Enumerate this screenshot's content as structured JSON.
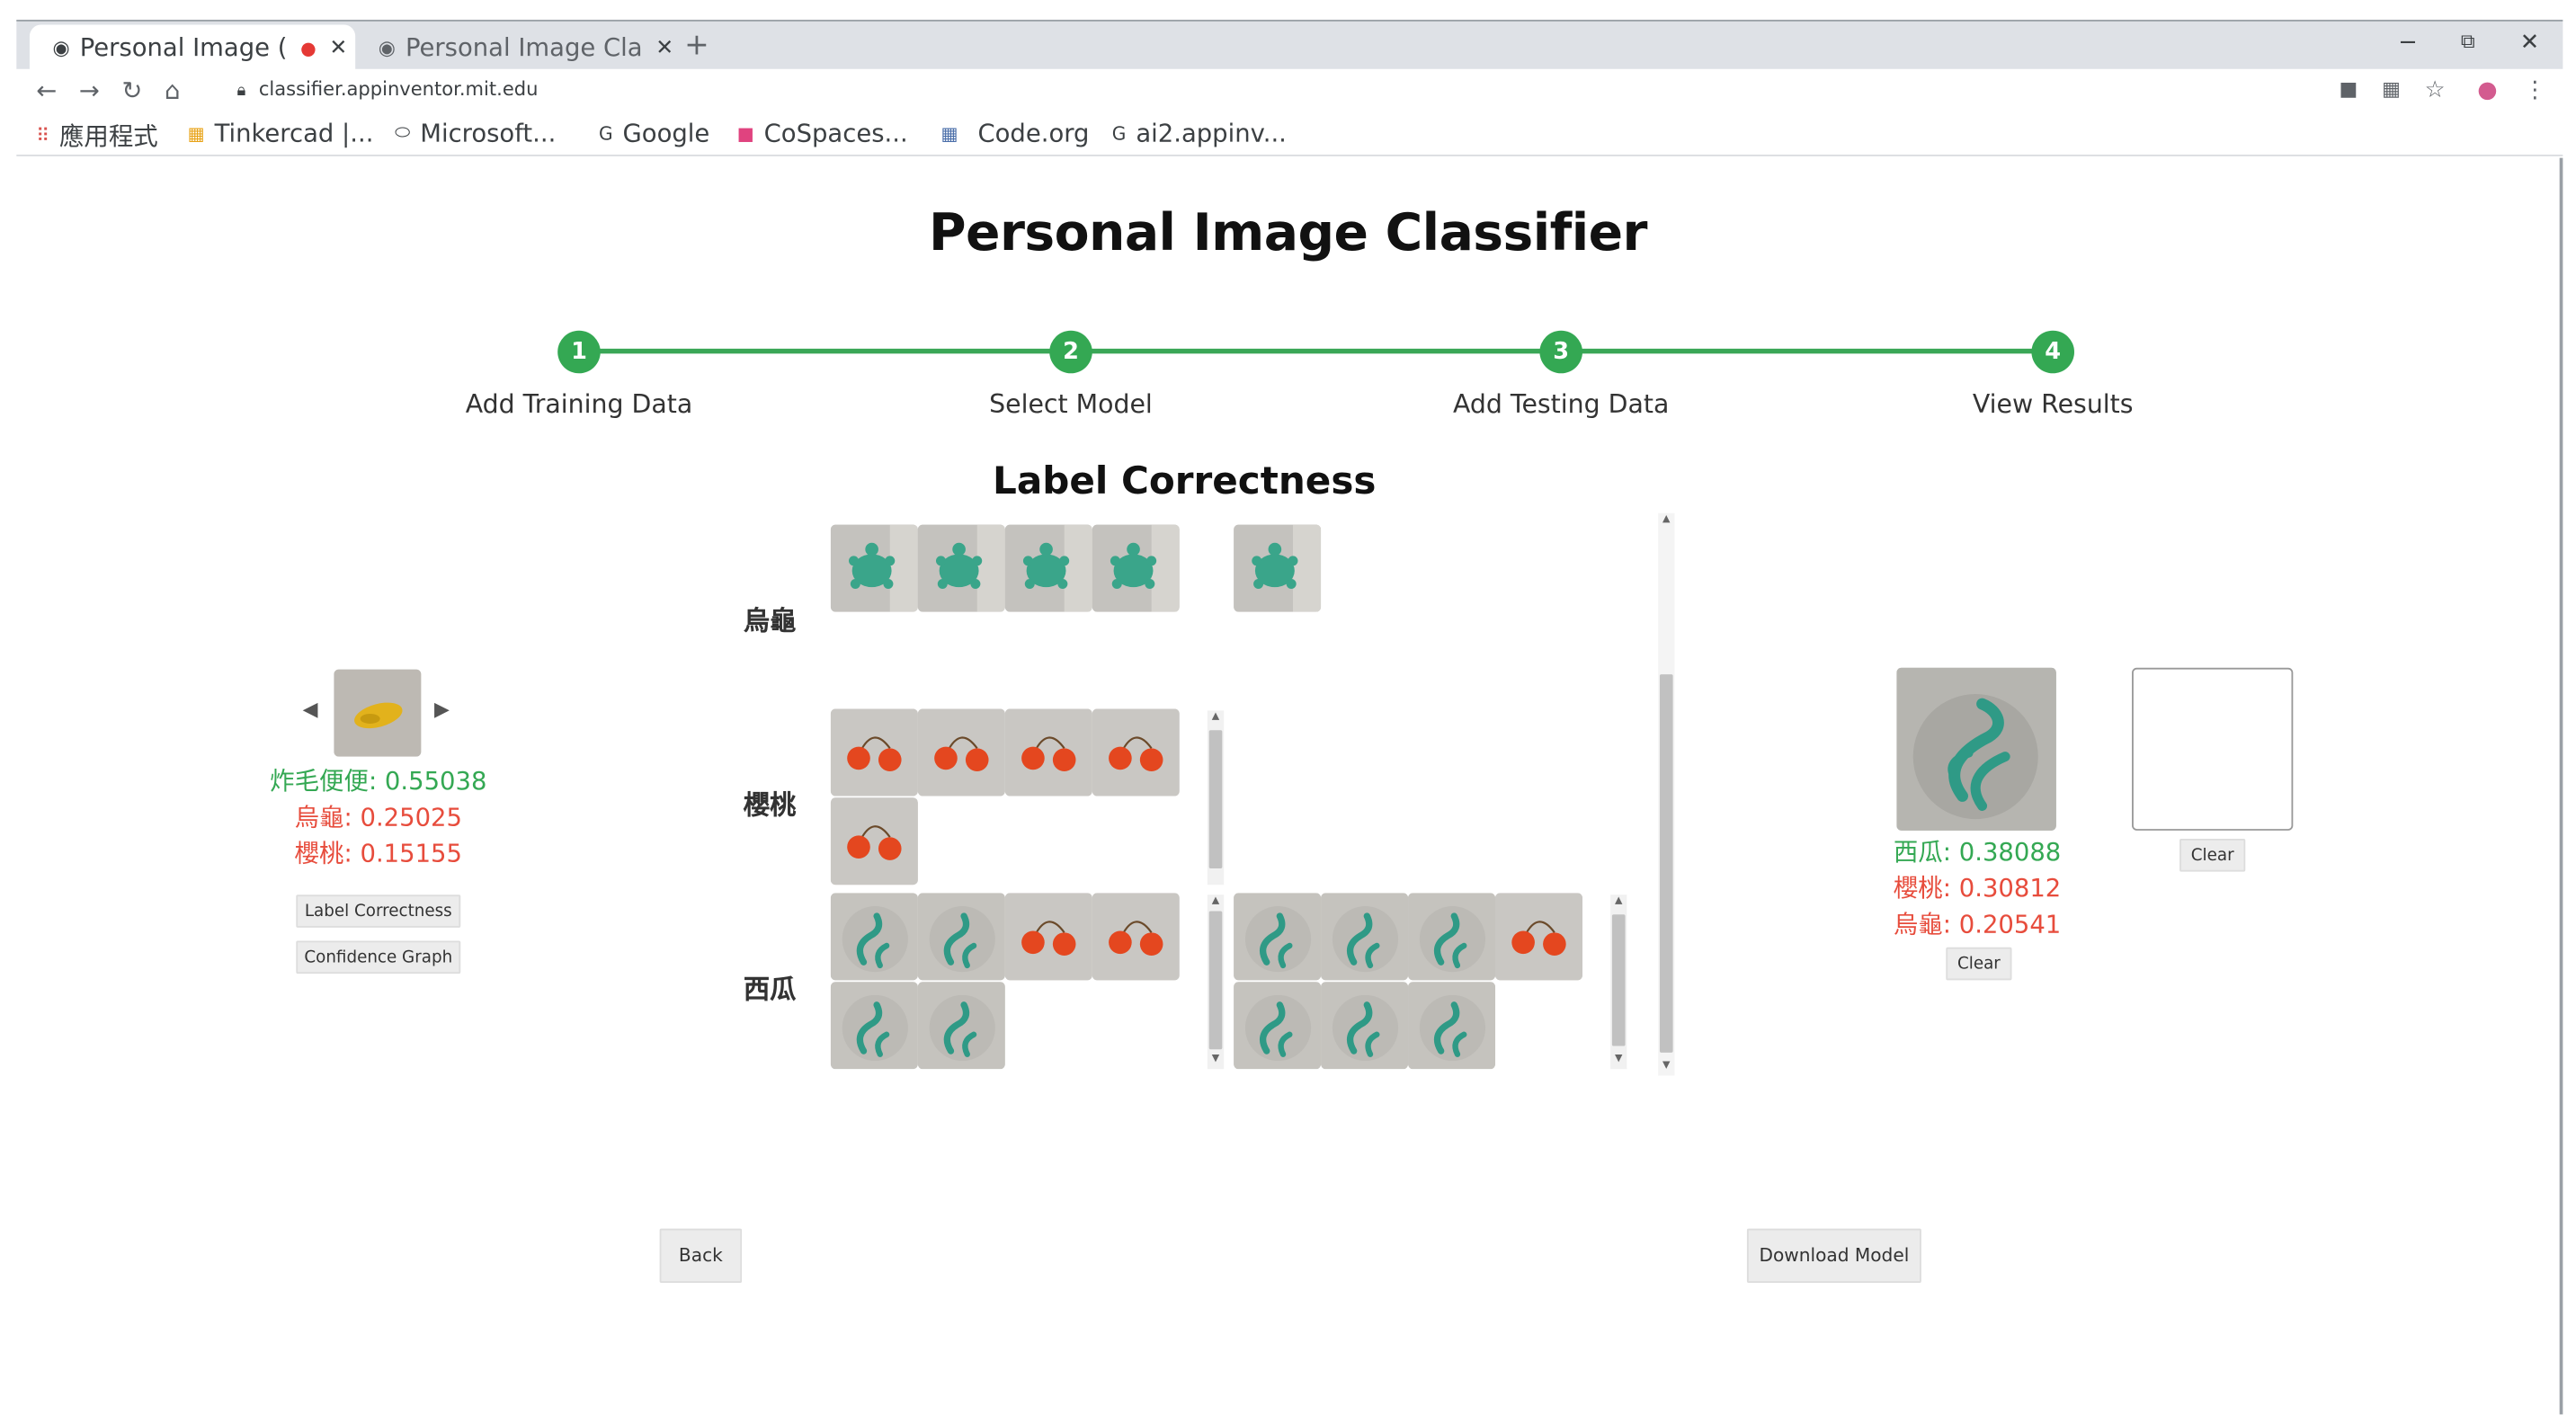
{
  "browser": {
    "tabs": [
      {
        "title": "Personal Image (",
        "active": true,
        "recording": true
      },
      {
        "title": "Personal Image Cla",
        "active": false,
        "recording": false
      }
    ],
    "new_tab_symbol": "+",
    "window_controls": {
      "minimize": "−",
      "restore": "⧉",
      "close": "✕"
    },
    "url": "classifier.appinventor.mit.edu",
    "bookmarks": [
      {
        "label": "應用程式",
        "icon": "apps-grid-icon"
      },
      {
        "label": "Tinkercad |...",
        "icon": "tinkercad-icon"
      },
      {
        "label": "Microsoft...",
        "icon": "microsoft-icon"
      },
      {
        "label": "Google",
        "icon": "google-icon"
      },
      {
        "label": "CoSpaces...",
        "icon": "cospaces-icon"
      },
      {
        "label": "Code.org",
        "icon": "codeorg-icon"
      },
      {
        "label": "ai2.appinv...",
        "icon": "google-icon"
      }
    ]
  },
  "page": {
    "title": "Personal Image Classifier",
    "steps": [
      {
        "number": "1",
        "label": "Add Training Data"
      },
      {
        "number": "2",
        "label": "Select Model"
      },
      {
        "number": "3",
        "label": "Add Testing Data"
      },
      {
        "number": "4",
        "label": "View Results"
      }
    ],
    "section_title": "Label Correctness",
    "rows": [
      {
        "label": "烏龜",
        "left_images": [
          "turtle",
          "turtle",
          "turtle",
          "turtle"
        ],
        "right_images": [
          "turtle"
        ]
      },
      {
        "label": "櫻桃",
        "left_images": [
          "cherry",
          "cherry",
          "cherry",
          "cherry",
          "cherry"
        ],
        "right_images": []
      },
      {
        "label": "西瓜",
        "left_images": [
          "watermelon",
          "watermelon",
          "cherry",
          "cherry",
          "watermelon",
          "watermelon"
        ],
        "right_images": [
          "watermelon",
          "watermelon",
          "watermelon",
          "cherry",
          "watermelon",
          "watermelon",
          "watermelon"
        ]
      }
    ],
    "left_panel": {
      "prev_symbol": "◀",
      "next_symbol": "▶",
      "confidences": [
        {
          "label": "炸毛便便",
          "value": "0.55038",
          "color": "#34a853"
        },
        {
          "label": "烏龜",
          "value": "0.25025",
          "color": "#e74c3c"
        },
        {
          "label": "櫻桃",
          "value": "0.15155",
          "color": "#e74c3c"
        }
      ],
      "label_correctness_button": "Label Correctness",
      "confidence_graph_button": "Confidence Graph"
    },
    "right_panel": {
      "confidences": [
        {
          "label": "西瓜",
          "value": "0.38088",
          "color": "#34a853"
        },
        {
          "label": "櫻桃",
          "value": "0.30812",
          "color": "#e74c3c"
        },
        {
          "label": "烏龜",
          "value": "0.20541",
          "color": "#e74c3c"
        }
      ],
      "clear_button_1": "Clear",
      "clear_button_2": "Clear"
    },
    "back_button": "Back",
    "download_button": "Download Model"
  },
  "colors": {
    "accent_green": "#34a853",
    "error_red": "#e74c3c"
  }
}
